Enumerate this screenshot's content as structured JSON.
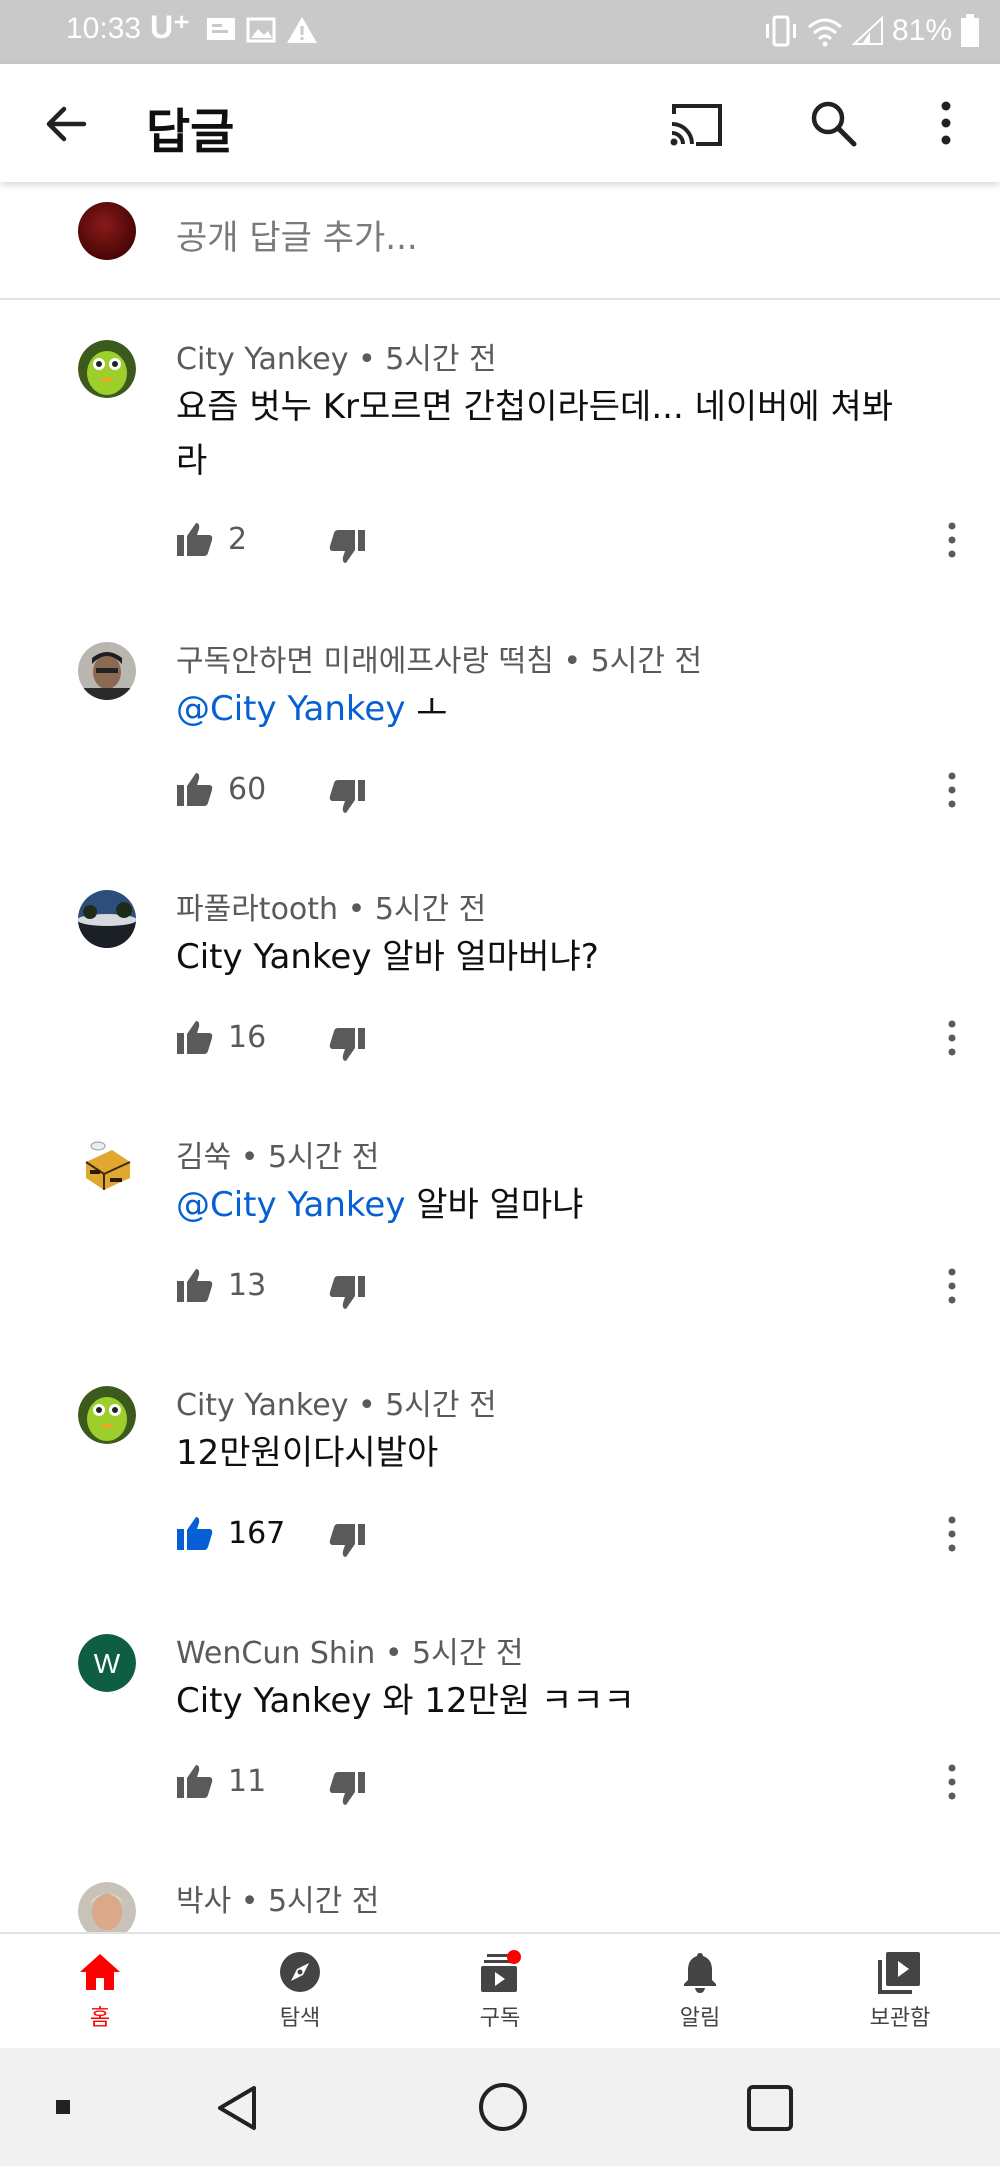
{
  "status": {
    "time": "10:33",
    "carrier": "U⁺",
    "battery": "81%"
  },
  "header": {
    "title": "답글"
  },
  "reply_input": {
    "placeholder": "공개 답글 추가..."
  },
  "comments": [
    {
      "author_meta": "City Yankey • 5시간 전",
      "mention": "",
      "text": "요즘 벗누 Kr모르면 간첩이라든데... 네이버에 쳐봐라",
      "likes": "2",
      "liked": false,
      "avatar": "bird"
    },
    {
      "author_meta": "구독안하면 미래에프사랑 떡침 • 5시간 전",
      "mention": "@City Yankey",
      "text": " ㅗ",
      "likes": "60",
      "liked": false,
      "avatar": "photo-man"
    },
    {
      "author_meta": "파풀라tooth • 5시간 전",
      "mention": "",
      "text": "City Yankey 알바 얼마버냐?",
      "likes": "16",
      "liked": false,
      "avatar": "landscape"
    },
    {
      "author_meta": "김쑥 • 5시간 전",
      "mention": "@City Yankey",
      "text": " 알바 얼마냐",
      "likes": "13",
      "liked": false,
      "avatar": "bee"
    },
    {
      "author_meta": "City Yankey • 5시간 전",
      "mention": "",
      "text": "12만원이다시발아",
      "likes": "167",
      "liked": true,
      "avatar": "bird"
    },
    {
      "author_meta": "WenCun Shin • 5시간 전",
      "mention": "",
      "text": "City Yankey 와 12만원 ㅋㅋㅋ",
      "likes": "11",
      "liked": false,
      "avatar": "letter-w",
      "avatar_letter": "W"
    },
    {
      "author_meta": "박사 • 5시간 전",
      "mention": "",
      "text": "",
      "likes": "",
      "liked": false,
      "avatar": "photo-elder"
    }
  ],
  "bottom_nav": [
    {
      "label": "홈",
      "icon": "home-icon",
      "active": true
    },
    {
      "label": "탐색",
      "icon": "explore-icon",
      "active": false
    },
    {
      "label": "구독",
      "icon": "subscriptions-icon",
      "active": false,
      "badge": true
    },
    {
      "label": "알림",
      "icon": "bell-icon",
      "active": false
    },
    {
      "label": "보관함",
      "icon": "library-icon",
      "active": false
    }
  ],
  "colors": {
    "accent": "#ff0000",
    "link": "#065fd4",
    "liked": "#065fd4",
    "status_bar": "#c9c9c9"
  }
}
